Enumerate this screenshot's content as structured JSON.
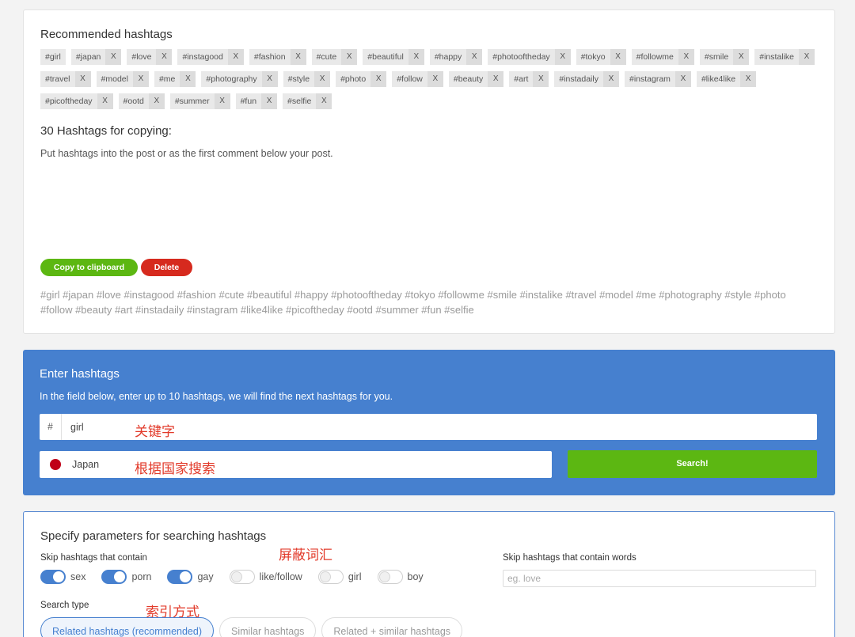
{
  "recommended": {
    "title": "Recommended hashtags",
    "tags": [
      "#girl",
      "#japan",
      "#love",
      "#instagood",
      "#fashion",
      "#cute",
      "#beautiful",
      "#happy",
      "#photooftheday",
      "#tokyo",
      "#followme",
      "#smile",
      "#instalike",
      "#travel",
      "#model",
      "#me",
      "#photography",
      "#style",
      "#photo",
      "#follow",
      "#beauty",
      "#art",
      "#instadaily",
      "#instagram",
      "#like4like",
      "#picoftheday",
      "#ootd",
      "#summer",
      "#fun",
      "#selfie"
    ],
    "remove_label": "X"
  },
  "copy_section": {
    "title": "30 Hashtags for copying:",
    "description": "Put hashtags into the post or as the first comment below your post.",
    "copy_button": "Copy to clipboard",
    "delete_button": "Delete",
    "hashtag_list": "#girl #japan #love #instagood #fashion #cute #beautiful #happy #photooftheday #tokyo #followme #smile #instalike #travel #model #me #photography #style #photo #follow #beauty #art #instadaily #instagram #like4like #picoftheday #ootd #summer #fun #selfie"
  },
  "enter": {
    "title": "Enter hashtags",
    "description": "In the field below, enter up to 10 hashtags, we will find the next hashtags for you.",
    "hash_symbol": "#",
    "hashtag_value": "girl",
    "annotation_keyword": "关键字",
    "country_value": "Japan",
    "country_flag_color": "#c00017",
    "annotation_country": "根据国家搜索",
    "search_button": "Search!"
  },
  "params": {
    "title": "Specify parameters for searching hashtags",
    "skip_label": "Skip hashtags that contain",
    "annotation_block": "屏蔽词汇",
    "toggles": [
      {
        "label": "sex",
        "on": true
      },
      {
        "label": "porn",
        "on": true
      },
      {
        "label": "gay",
        "on": true
      },
      {
        "label": "like/follow",
        "on": false
      },
      {
        "label": "girl",
        "on": false
      },
      {
        "label": "boy",
        "on": false
      }
    ],
    "skip_words_label": "Skip hashtags that contain words",
    "skip_words_placeholder": "eg. love",
    "search_type_label": "Search type",
    "annotation_index": "索引方式",
    "search_types": [
      "Related hashtags (recommended)",
      "Similar hashtags",
      "Related + similar hashtags"
    ],
    "active_search_type": 0
  },
  "colors": {
    "accent_blue": "#4680cf",
    "green": "#5cb712",
    "red": "#d62a1e",
    "annotation_red": "#e23a2a"
  }
}
